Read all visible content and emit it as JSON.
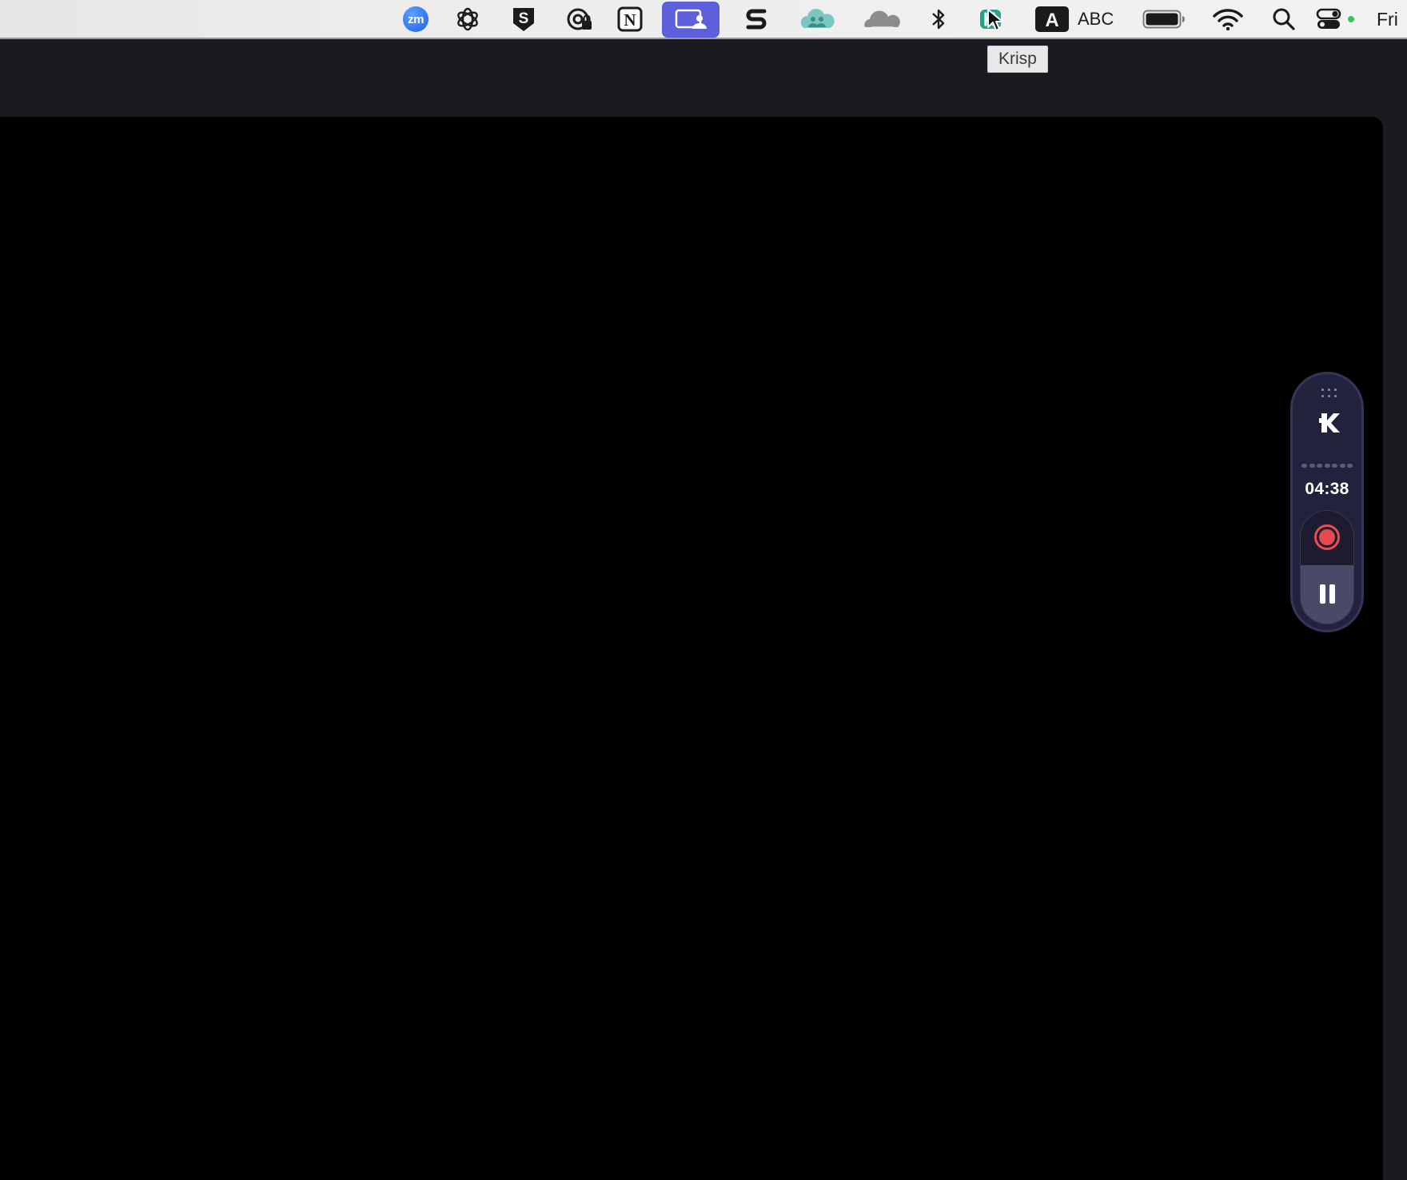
{
  "menubar": {
    "items": [
      {
        "name": "zoom",
        "icon": "zoom-icon",
        "label": "zm"
      },
      {
        "name": "chatgpt",
        "icon": "chatgpt-icon"
      },
      {
        "name": "setapp",
        "icon": "s-shield-icon"
      },
      {
        "name": "vpn",
        "icon": "vpn-lock-icon"
      },
      {
        "name": "notion",
        "icon": "notion-icon",
        "label": "N"
      },
      {
        "name": "screen-share",
        "icon": "screen-share-icon"
      },
      {
        "name": "scrivener",
        "icon": "s-logo-icon"
      },
      {
        "name": "cloud-people",
        "icon": "cloud-people-icon"
      },
      {
        "name": "cloudflare",
        "icon": "cloudflare-icon"
      },
      {
        "name": "bluetooth",
        "icon": "bluetooth-icon"
      },
      {
        "name": "krisp",
        "icon": "krisp-icon"
      },
      {
        "name": "input-source-a",
        "icon": "input-source-icon",
        "label": "A"
      },
      {
        "name": "input-source-text",
        "label": "ABC"
      },
      {
        "name": "battery",
        "icon": "battery-icon"
      },
      {
        "name": "wifi",
        "icon": "wifi-icon"
      },
      {
        "name": "spotlight",
        "icon": "search-icon"
      },
      {
        "name": "control-center",
        "icon": "control-center-icon"
      }
    ],
    "clock": "Fri"
  },
  "tooltip": {
    "text": "Krisp"
  },
  "krisp_widget": {
    "logo": "K",
    "timer": "04:38",
    "record_color": "#e84b4f"
  }
}
